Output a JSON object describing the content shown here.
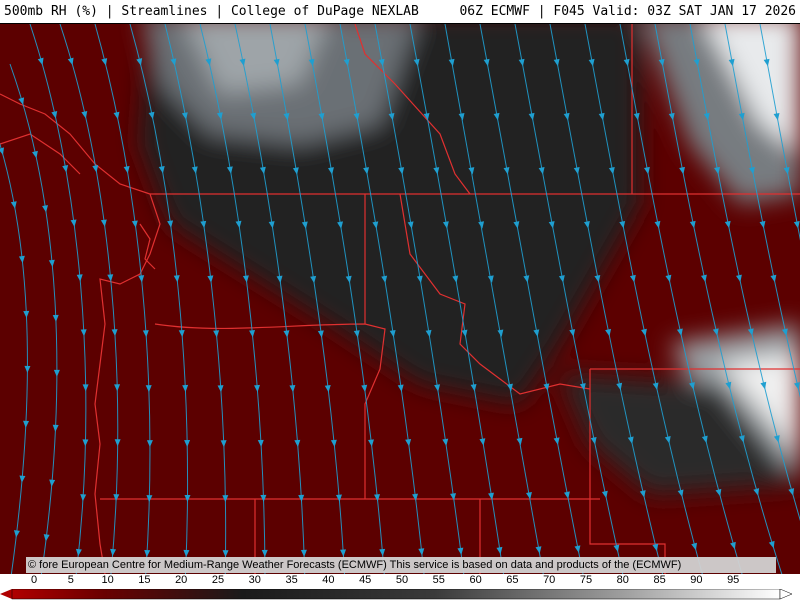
{
  "header": {
    "left": "500mb RH (%) | Streamlines | College of DuPage NEXLAB",
    "right": "06Z ECMWF | F045 Valid: 03Z SAT JAN 17 2026"
  },
  "credit": "© fore European Centre for Medium-Range Weather Forecasts (ECMWF)  This service is based on data and products of the (ECMWF)",
  "legend": {
    "ticks": [
      "0",
      "5",
      "10",
      "15",
      "20",
      "25",
      "30",
      "35",
      "40",
      "45",
      "50",
      "55",
      "60",
      "65",
      "70",
      "75",
      "80",
      "85",
      "90",
      "95"
    ]
  },
  "colors": {
    "dry": "#5a0000",
    "moist_mid": "#2a2a2a",
    "moist_high": "#ffffff",
    "streamline": "#1f9fd0",
    "border": "#e03030"
  },
  "icons": {
    "legend_left": "triangle-left-icon",
    "legend_right": "triangle-right-icon"
  }
}
